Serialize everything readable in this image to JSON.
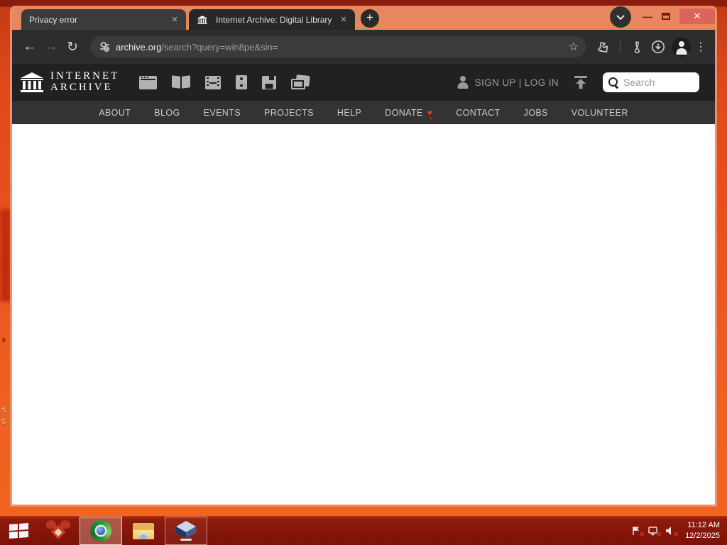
{
  "desktop": {
    "fragments": [
      "s",
      "S",
      "S"
    ]
  },
  "browser": {
    "tabs": [
      {
        "title": "Privacy error",
        "close": "✕"
      },
      {
        "title": "Internet Archive: Digital Library",
        "close": "✕"
      }
    ],
    "new_tab_label": "+",
    "window_controls": {
      "close_glyph": "✕"
    },
    "toolbar": {
      "back_glyph": "←",
      "forward_glyph": "→",
      "reload_glyph": "↻",
      "url_host": "archive.org",
      "url_path": "/search?query=win8pe&sin=",
      "star_glyph": "☆",
      "kebab_glyph": "⋮"
    }
  },
  "archive": {
    "logo_line1": "INTERNET",
    "logo_line2": "ARCHIVE",
    "media_icons": [
      "web",
      "texts",
      "video",
      "audio",
      "software",
      "images"
    ],
    "signup_login": "SIGN UP | LOG IN",
    "search_placeholder": "Search",
    "nav": [
      "ABOUT",
      "BLOG",
      "EVENTS",
      "PROJECTS",
      "HELP",
      "DONATE",
      "CONTACT",
      "JOBS",
      "VOLUNTEER"
    ],
    "donate_heart": "♥"
  },
  "taskbar": {
    "time": "11:12 AM",
    "date": "12/2/2025"
  },
  "colors": {
    "titlebar_salmon": "#e8875f",
    "close_button_red": "#da655a",
    "heart_red": "#e53935",
    "taskbar_maroon": "#8c1a0b",
    "header_black": "#212121",
    "nav_gray": "#333333"
  }
}
